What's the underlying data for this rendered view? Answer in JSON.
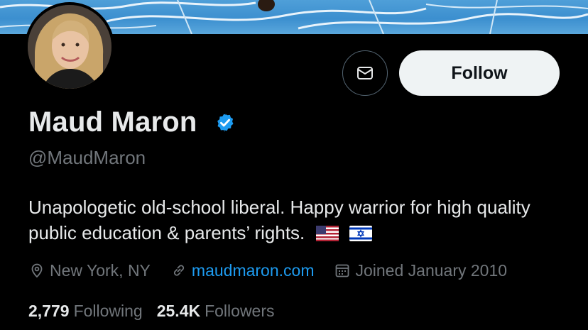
{
  "profile": {
    "name": "Maud Maron",
    "handle": "@MaudMaron",
    "bio": "Unapologetic old-school liberal. Happy warrior for high quality public education & parents’ rights.",
    "bio_flags": [
      "us-flag-icon",
      "israel-flag-icon"
    ],
    "location": "New York, NY",
    "website": "maudmaron.com",
    "joined": "Joined January 2010",
    "following_count": "2,779",
    "following_label": "Following",
    "followers_count": "25.4K",
    "followers_label": "Followers"
  },
  "actions": {
    "follow_label": "Follow",
    "message_icon": "envelope-icon"
  },
  "colors": {
    "background": "#000000",
    "primary_text": "#e7e9ea",
    "secondary_text": "#71767b",
    "link": "#1d9bf0",
    "verified_badge": "#1d9bf0",
    "follow_button_bg": "#eff3f4"
  },
  "icons": {
    "location": "location-pin-icon",
    "link": "link-icon",
    "calendar": "calendar-icon",
    "verified": "verified-badge-icon"
  }
}
